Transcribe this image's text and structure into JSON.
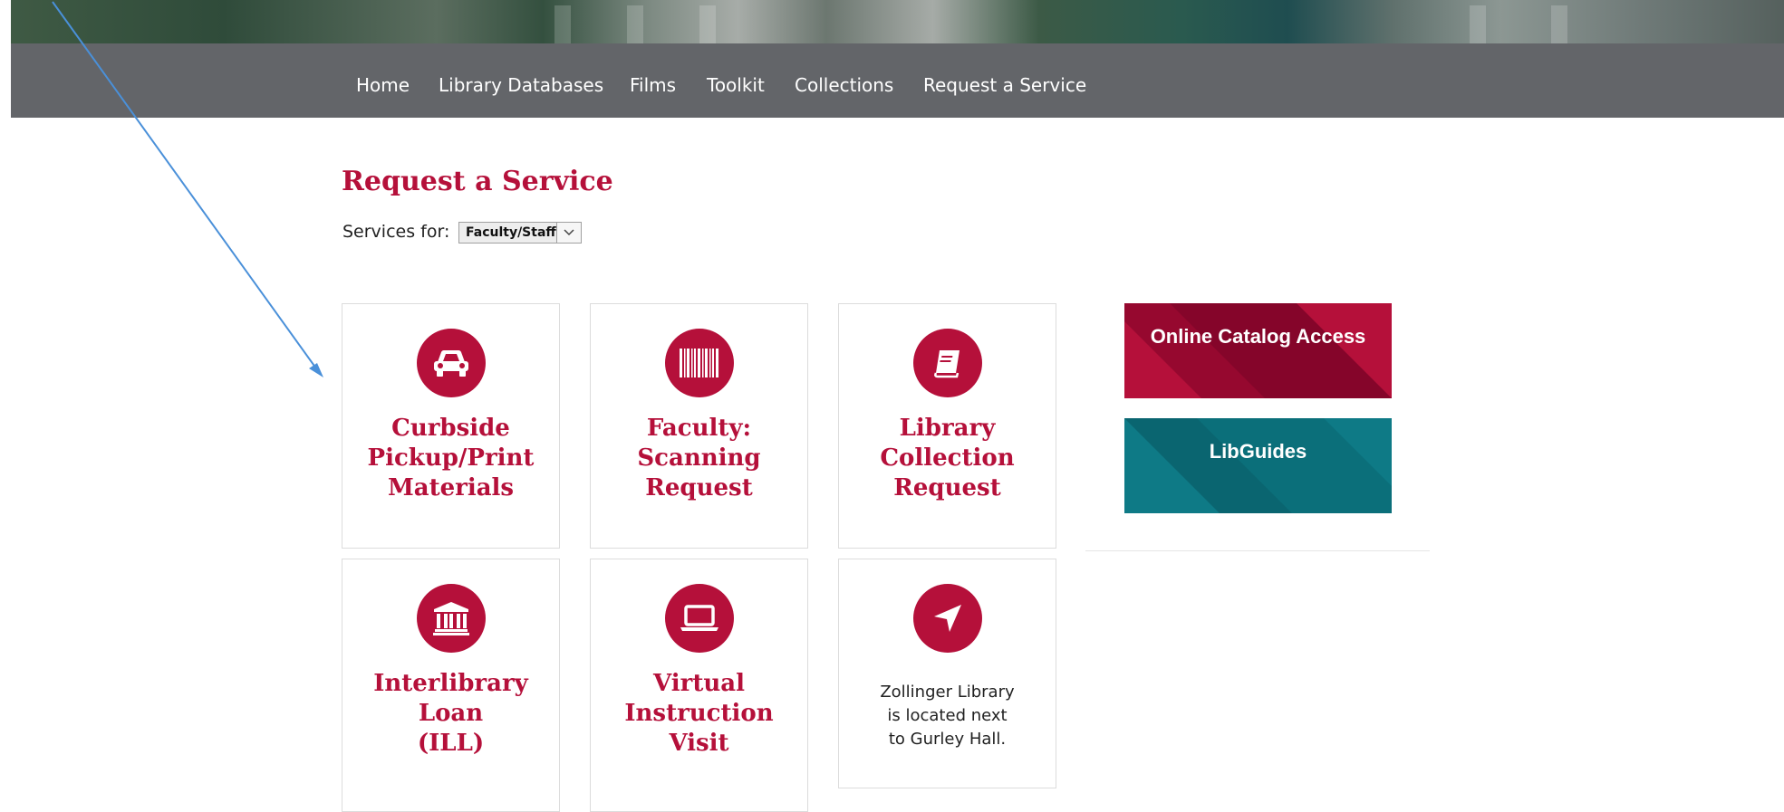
{
  "nav": {
    "items": [
      "Home",
      "Library Databases",
      "Films",
      "Toolkit",
      "Collections",
      "Request a Service"
    ]
  },
  "page": {
    "title": "Request a Service",
    "services_for_label": "Services for:",
    "audience_select": {
      "selected": "Faculty/Staff"
    }
  },
  "cards": [
    {
      "title": "Curbside\nPickup/Print\nMaterials",
      "icon": "car-icon"
    },
    {
      "title": "Faculty:\nScanning\nRequest",
      "icon": "barcode-icon"
    },
    {
      "title": "Library\nCollection\nRequest",
      "icon": "book-icon"
    },
    {
      "title": "Interlibrary\nLoan\n(ILL)",
      "icon": "bank-icon"
    },
    {
      "title": "Virtual\nInstruction\nVisit",
      "icon": "laptop-icon"
    },
    {
      "text": "Zollinger Library\nis located next\nto Gurley Hall.",
      "icon": "location-arrow-icon"
    }
  ],
  "promos": [
    {
      "label": "Online Catalog Access",
      "color": "#b5103a"
    },
    {
      "label": "LibGuides",
      "color": "#0e7a86"
    }
  ],
  "colors": {
    "accent": "#b5103a",
    "nav_bg": "#636569",
    "annotation_arrow": "#4a90d9"
  }
}
